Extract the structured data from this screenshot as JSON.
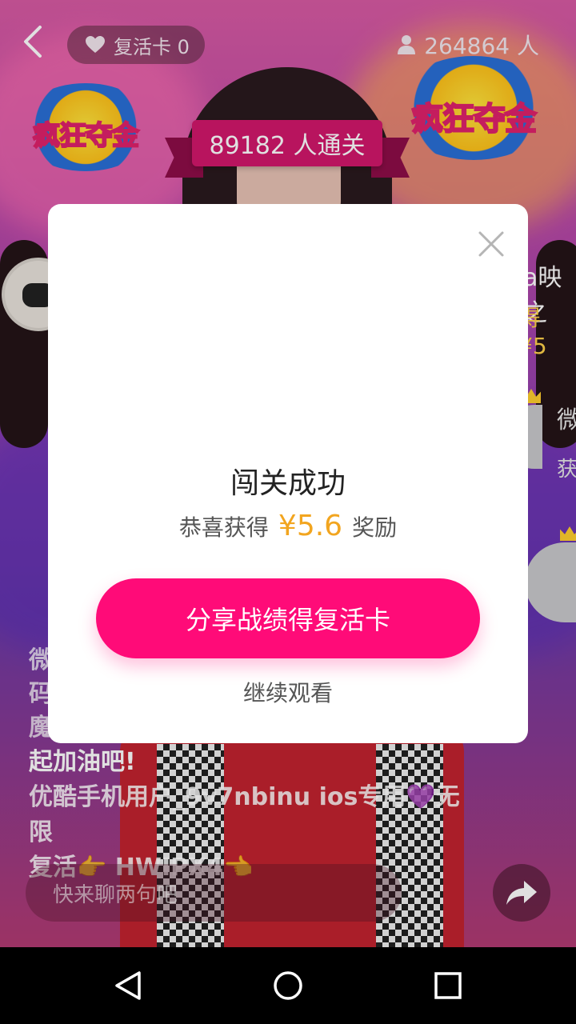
{
  "top_bar": {
    "revive_cards_label": "复活卡 0",
    "viewer_count": "264864 人"
  },
  "stage": {
    "logo_text": "疯狂夺金",
    "pass_banner": "89182 人通关",
    "right_peek_1": "a映之",
    "right_peek_2": "得 ¥5",
    "right_peek_3": "微",
    "right_peek_4": "获"
  },
  "chat": {
    "faded_1": "微",
    "faded_2": "码",
    "faded_3": "魔",
    "line_1": "起加油吧!",
    "line_2": "优酷手机用户_9v7nbinu ios专用💜无限",
    "line_3": "复活👉 HWIPX4👈",
    "input_placeholder": "快来聊两句吧"
  },
  "modal": {
    "title": "闯关成功",
    "reward_prefix": "恭喜获得",
    "reward_amount": "¥5.6",
    "reward_suffix": "奖励",
    "share_button": "分享战绩得复活卡",
    "continue_link": "继续观看"
  },
  "colors": {
    "accent": "#ff0b78",
    "reward": "#f2a51f",
    "banner": "#d2176b"
  }
}
